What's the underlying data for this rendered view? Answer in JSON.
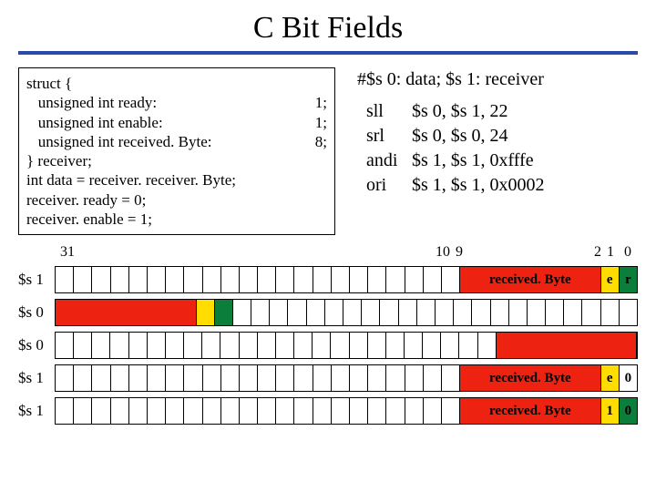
{
  "title": "C Bit Fields",
  "code": {
    "l0": "struct {",
    "l1": "   unsigned int ready:",
    "v1": "1;",
    "l2": "   unsigned int enable:",
    "v2": "1;",
    "l3": "   unsigned int received. Byte:",
    "v3": "8;",
    "l4": "} receiver;",
    "l5": "int data = receiver. receiver. Byte;",
    "l6": "receiver. ready = 0;",
    "l7": "receiver. enable = 1;"
  },
  "asm": {
    "header": "#$s 0: data;  $s 1: receiver",
    "rows": [
      {
        "op": "sll",
        "args": "$s 0, $s 1, 22"
      },
      {
        "op": "srl",
        "args": "$s 0, $s 0, 24"
      },
      {
        "op": "andi",
        "args": "$s 1, $s 1, 0xfffe"
      },
      {
        "op": "ori",
        "args": "$s 1, $s 1, 0x0002"
      }
    ]
  },
  "bitlbl": {
    "b31": "31",
    "b10": "10",
    "b9": "9",
    "b2": "2",
    "b1": "1",
    "b0": "0"
  },
  "bytelabel": "received. Byte",
  "e": "e",
  "r": "r",
  "one": "1",
  "zero": "0",
  "reg": {
    "s1": "$s 1",
    "s0": "$s 0"
  }
}
